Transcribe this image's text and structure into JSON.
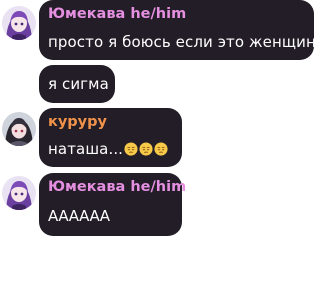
{
  "colors": {
    "bubble": "#221d27",
    "author_pink": "#e58fe0",
    "author_orange": "#f0924a",
    "text": "#ffffff",
    "background": "#ffffff"
  },
  "messages": [
    {
      "author": "Юмекава he/him",
      "author_color": "#e58fe0",
      "avatar": "purple-haired-avatar",
      "lines": [
        "просто я боюсь если это женщина",
        "я сигма"
      ]
    },
    {
      "author": "кypypy",
      "author_color": "#f0924a",
      "avatar": "dark-haired-avatar",
      "text": "наташа...",
      "emojis": [
        "pensive-face-emoji",
        "pensive-face-emoji",
        "pensive-face-emoji"
      ]
    },
    {
      "author": "Юмекава he/him",
      "author_color": "#e58fe0",
      "avatar": "purple-haired-avatar",
      "text": "АААААА"
    }
  ]
}
